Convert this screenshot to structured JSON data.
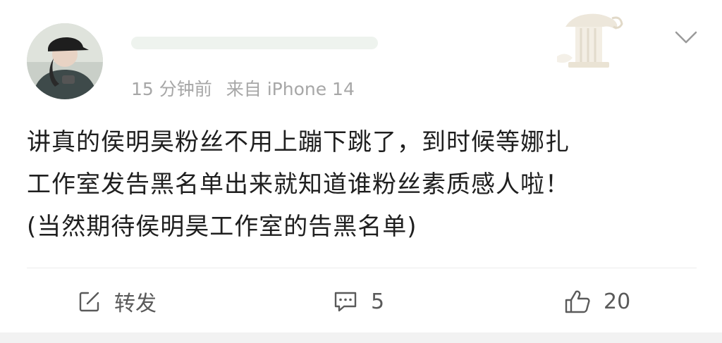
{
  "post": {
    "meta": {
      "time": "15 分钟前",
      "source": "来自 iPhone 14"
    },
    "body_lines": [
      "讲真的侯明昊粉丝不用上蹦下跳了，到时候等娜扎",
      "工作室发告黑名单出来就知道谁粉丝素质感人啦！",
      "(当然期待侯明昊工作室的告黑名单)"
    ],
    "actions": {
      "repost_label": "转发",
      "comment_count": "5",
      "like_count": "20"
    }
  },
  "icons": {
    "menu": "chevron-down-icon",
    "repost": "share-edit-icon",
    "comment": "comment-icon",
    "like": "thumbs-up-icon"
  },
  "colors": {
    "meta_text": "#a7a7a7",
    "body_text": "#1f1f1f",
    "action_text": "#5a5a5a"
  }
}
